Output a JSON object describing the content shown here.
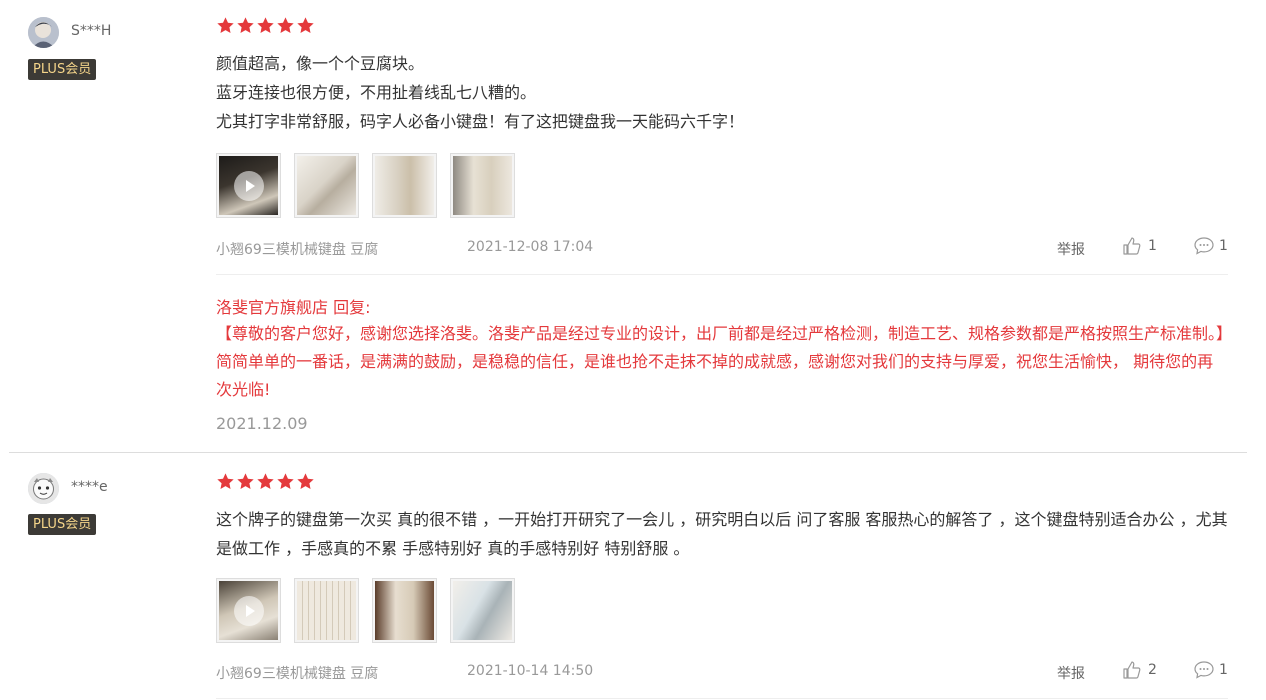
{
  "reviews": [
    {
      "username": "S***H",
      "badge": "PLUS会员",
      "rating": 5,
      "lines": [
        "颜值超高，像一个个豆腐块。",
        "蓝牙连接也很方便，不用扯着线乱七八糟的。",
        "尤其打字非常舒服，码字人必备小键盘！有了这把键盘我一天能码六千字！"
      ],
      "images": [
        "video",
        "photo",
        "photo",
        "photo"
      ],
      "product": "小翘69三模机械键盘 豆腐",
      "date": "2021-12-08 17:04",
      "report_label": "举报",
      "likes": "1",
      "comments": "1",
      "reply": {
        "header": "洛斐官方旗舰店 回复:",
        "text": "【尊敬的客户您好，感谢您选择洛斐。洛斐产品是经过专业的设计，出厂前都是经过严格检测，制造工艺、规格参数都是严格按照生产标准制。】简简单单的一番话，是满满的鼓励，是稳稳的信任，是谁也抢不走抹不掉的成就感，感谢您对我们的支持与厚爱，祝您生活愉快， 期待您的再次光临!",
        "date": "2021.12.09"
      }
    },
    {
      "username": "****e",
      "badge": "PLUS会员",
      "rating": 5,
      "lines": [
        "这个牌子的键盘第一次买 真的很不错 ，一开始打开研究了一会儿 ，研究明白以后 问了客服 客服热心的解答了 ，这个键盘特别适合办公 ，尤其是做工作 ，手感真的不累 手感特别好 真的手感特别好 特别舒服 。"
      ],
      "images": [
        "video",
        "photo",
        "photo",
        "photo"
      ],
      "product": "小翘69三模机械键盘 豆腐",
      "date": "2021-10-14 14:50",
      "report_label": "举报",
      "likes": "2",
      "comments": "1"
    }
  ],
  "colors": {
    "star": "#e4393c",
    "reply": "#e4393c",
    "badge_bg": "#3c3a36",
    "badge_text": "#f5d58a"
  }
}
